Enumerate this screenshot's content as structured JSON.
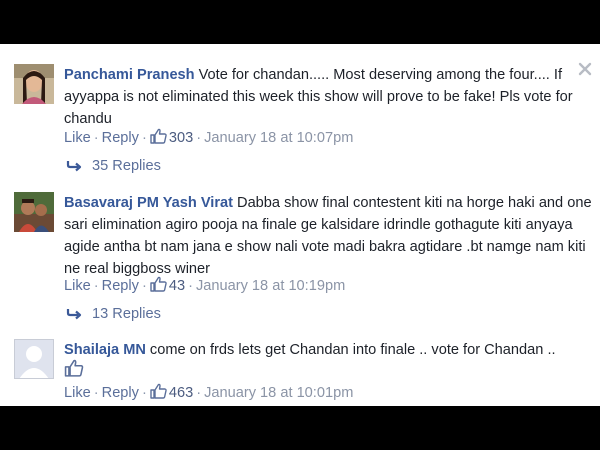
{
  "comments": [
    {
      "author": "Panchami Pranesh",
      "text": "Vote for chandan..... Most deserving among the four.... If ayyappa is not eliminated this week this show will prove to be fake! Pls vote for chandu",
      "like_label": "Like",
      "reply_label": "Reply",
      "likes": "303",
      "timestamp": "January 18 at 10:07pm",
      "replies_label": "35 Replies"
    },
    {
      "author": "Basavaraj PM Yash Virat",
      "text": "Dabba show final contestent kiti na horge haki and one sari elimination agiro pooja na finale ge kalsidare idrindle gothagute kiti anyaya agide antha bt nam jana e show nali vote madi bakra agtidare .bt namge nam kiti ne real biggboss winer",
      "like_label": "Like",
      "reply_label": "Reply",
      "likes": "43",
      "timestamp": "January 18 at 10:19pm",
      "replies_label": "13 Replies"
    },
    {
      "author": "Shailaja MN",
      "text": "come on frds lets get Chandan into finale .. vote for Chandan ..",
      "like_label": "Like",
      "reply_label": "Reply",
      "likes": "463",
      "timestamp": "January 18 at 10:01pm"
    }
  ],
  "icons": {
    "close": "close-icon",
    "like": "thumbs-up-icon",
    "reply_arrow": "reply-arrow-icon"
  },
  "colors": {
    "author": "#365899",
    "link": "#5b6f9a",
    "meta": "#8b94a6",
    "text": "#1d2129",
    "letterbox": "#000000"
  }
}
